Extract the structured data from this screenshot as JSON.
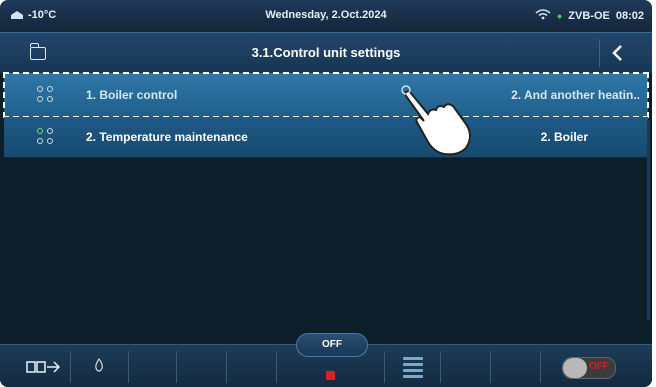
{
  "status": {
    "temperature": "-10°C",
    "date": "Wednesday, 2.Oct.2024",
    "device_name": "ZVB-OE",
    "time": "08:02"
  },
  "titlebar": {
    "title": "3.1.Control unit settings"
  },
  "list": {
    "items": [
      {
        "label": "1.  Boiler control",
        "value": "2. And another heatin.."
      },
      {
        "label": "2.  Temperature maintenance",
        "value": "2. Boiler"
      }
    ]
  },
  "bottombar": {
    "off_label": "OFF"
  },
  "colors": {
    "accent": "#1f5f8c",
    "status_red": "#e02020",
    "status_green": "#4cd14c"
  },
  "icons": [
    "folder-icon",
    "back-icon",
    "wifi-icon",
    "device-status-icon",
    "hand-pointer-icon",
    "mode-icon",
    "flame-icon",
    "menu-icon",
    "power-toggle-icon"
  ]
}
